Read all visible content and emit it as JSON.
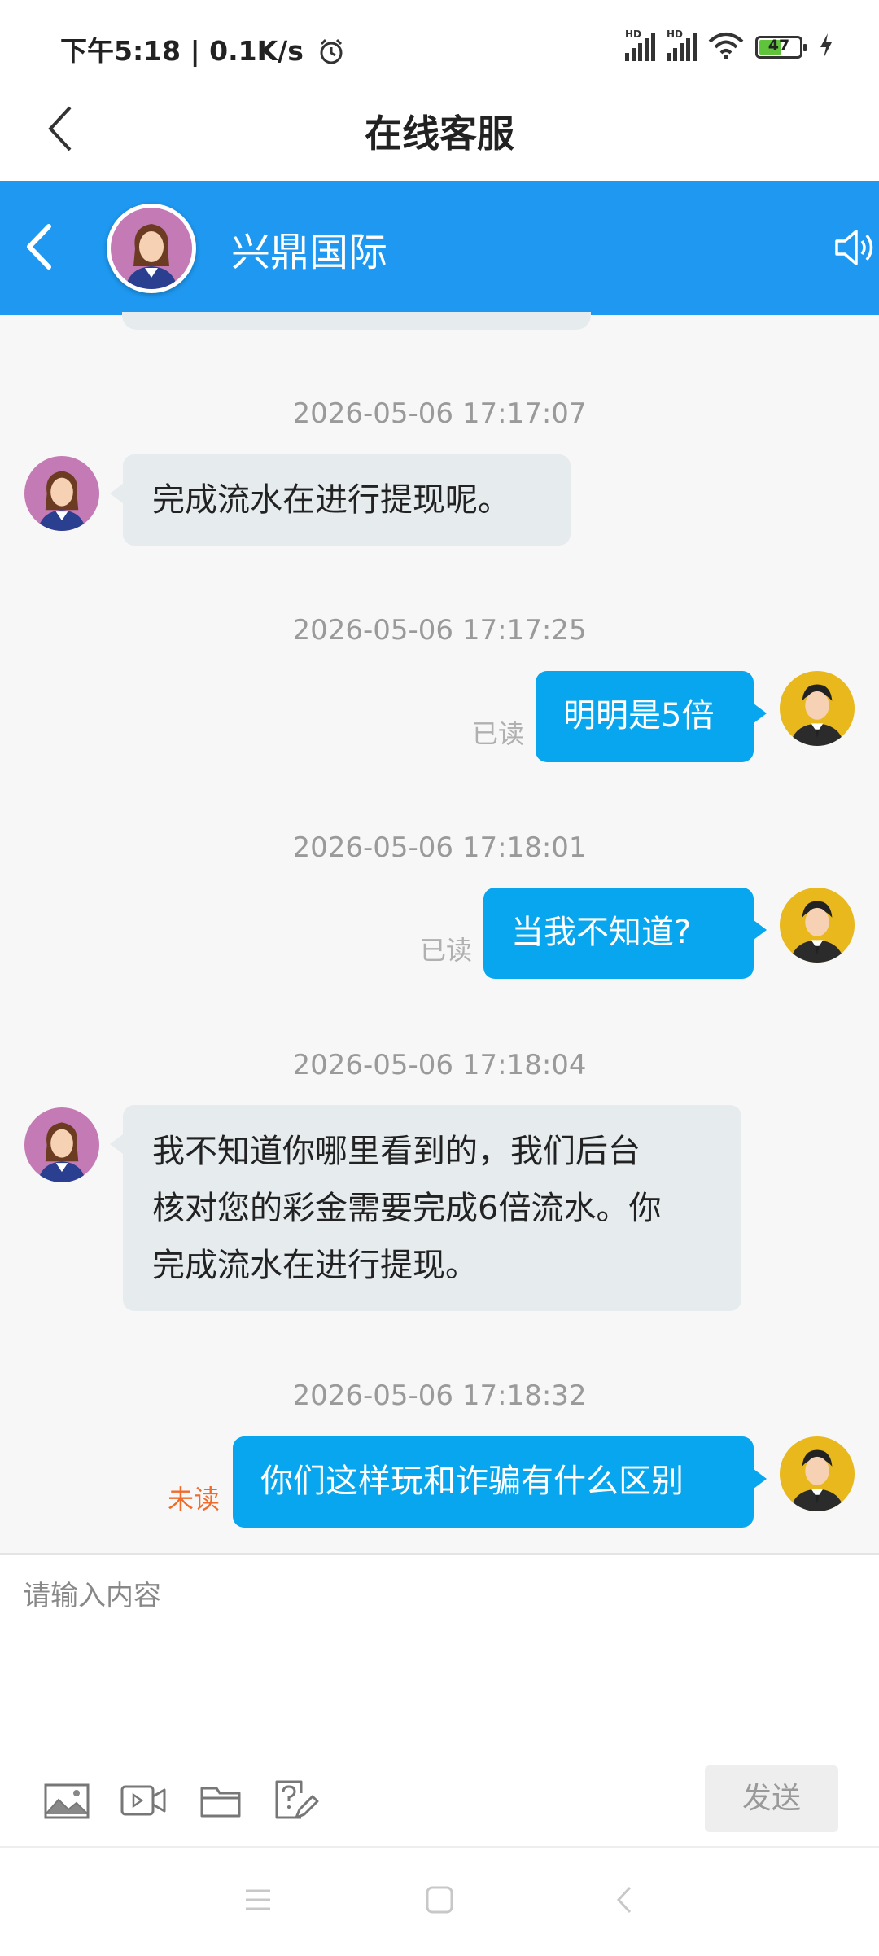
{
  "status_bar": {
    "time_speed": "下午5:18 | 0.1K/s",
    "battery": "47",
    "icons": [
      "alarm-icon",
      "signal-hd-icon",
      "signal-hd-icon",
      "wifi-icon",
      "battery-icon",
      "charging-icon"
    ]
  },
  "header": {
    "title": "在线客服",
    "back_icon": "chevron-left-icon"
  },
  "chat_header": {
    "name": "兴鼎国际",
    "back_icon": "chevron-left-icon",
    "speaker_icon": "speaker-icon"
  },
  "messages": [
    {
      "time": "2026-05-06 17:17:07",
      "side": "left",
      "text": "完成流水在进行提现呢。"
    },
    {
      "time": "2026-05-06 17:17:25",
      "side": "right",
      "text": "明明是5倍",
      "status": "已读"
    },
    {
      "time": "2026-05-06 17:18:01",
      "side": "right",
      "text": "当我不知道?",
      "status": "已读"
    },
    {
      "time": "2026-05-06 17:18:04",
      "side": "left",
      "lines": [
        "我不知道你哪里看到的，我们后台",
        "核对您的彩金需要完成6倍流水。你",
        "完成流水在进行提现。"
      ]
    },
    {
      "time": "2026-05-06 17:18:32",
      "side": "right",
      "text": "你们这样玩和诈骗有什么区别",
      "status": "未读"
    }
  ],
  "input": {
    "placeholder": "请输入内容",
    "send_label": "发送",
    "tools": [
      "image-icon",
      "video-icon",
      "folder-icon",
      "question-edit-icon"
    ]
  },
  "nav": {
    "icons": [
      "menu-icon",
      "home-icon",
      "back-icon"
    ]
  },
  "colors": {
    "header_blue": "#1e98f0",
    "bubble_blue": "#07a6ee",
    "bubble_gray": "#e6ebee",
    "unread": "#f06a2a"
  }
}
